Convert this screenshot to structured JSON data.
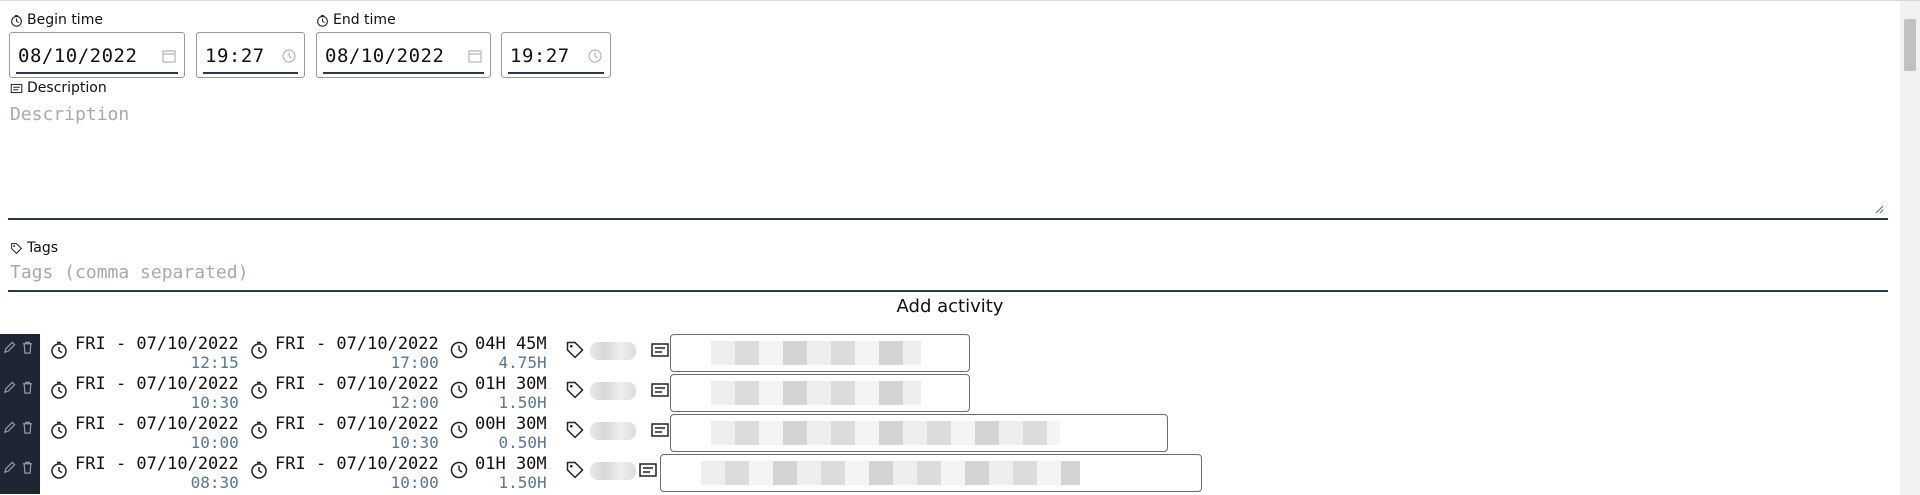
{
  "form": {
    "begin_label": "Begin time",
    "end_label": "End time",
    "begin_date": "08/10/2022",
    "begin_time": "19:27",
    "end_date": "08/10/2022",
    "end_time": "19:27",
    "description_label": "Description",
    "description_placeholder": "Description",
    "tags_label": "Tags",
    "tags_placeholder": "Tags (comma separated)",
    "add_label": "Add activity"
  },
  "activities": [
    {
      "start_day": "FRI - 07/10/2022",
      "start_time": "12:15",
      "end_day": "FRI - 07/10/2022",
      "end_time": "17:00",
      "duration": "04H 45M",
      "hours": "4.75H"
    },
    {
      "start_day": "FRI - 07/10/2022",
      "start_time": "10:30",
      "end_day": "FRI - 07/10/2022",
      "end_time": "12:00",
      "duration": "01H 30M",
      "hours": "1.50H"
    },
    {
      "start_day": "FRI - 07/10/2022",
      "start_time": "10:00",
      "end_day": "FRI - 07/10/2022",
      "end_time": "10:30",
      "duration": "00H 30M",
      "hours": "0.50H"
    },
    {
      "start_day": "FRI - 07/10/2022",
      "start_time": "08:30",
      "end_day": "FRI - 07/10/2022",
      "end_time": "10:00",
      "duration": "01H 30M",
      "hours": "1.50H"
    }
  ],
  "colors": {
    "accent_dark": "#1e2633",
    "subtext": "#5b7596",
    "placeholder": "#a3aab3"
  },
  "icons": [
    "clock-icon",
    "calendar-icon",
    "description-icon",
    "tag-icon",
    "edit-icon",
    "trash-icon",
    "hourglass-icon"
  ]
}
